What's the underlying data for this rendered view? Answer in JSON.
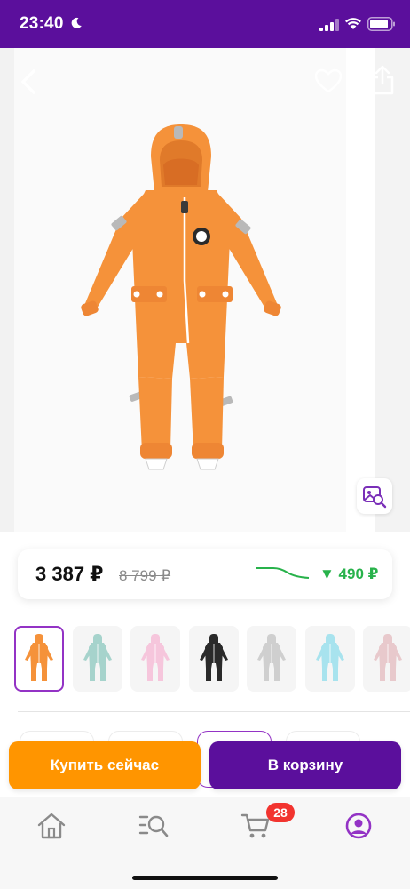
{
  "status_bar": {
    "time": "23:40",
    "background": "#5b0f9c"
  },
  "hero": {
    "icons": [
      "back-arrow-icon",
      "heart-icon",
      "share-icon",
      "visual-search-icon"
    ],
    "product_color": "#f5923a"
  },
  "price": {
    "current": "3 387 ₽",
    "old": "8 799 ₽",
    "drop": "▼ 490 ₽",
    "drop_color": "#28b24b"
  },
  "color_variants": [
    {
      "color": "#f5923a",
      "selected": true
    },
    {
      "color": "#a6d3cc",
      "selected": false
    },
    {
      "color": "#f6c6dc",
      "selected": false
    },
    {
      "color": "#2a2a2a",
      "selected": false
    },
    {
      "color": "#cfcfcf",
      "selected": false
    },
    {
      "color": "#a8e3ee",
      "selected": false
    },
    {
      "color": "#e8c9cc",
      "selected": false
    }
  ],
  "actions": {
    "buy_now": "Купить сейчас",
    "add_to_cart": "В корзину",
    "buy_now_color": "#ff9500",
    "cart_color": "#5b0f9c"
  },
  "bottom_nav": {
    "items": [
      "home-icon",
      "catalog-search-icon",
      "cart-icon",
      "profile-icon"
    ],
    "cart_badge": "28",
    "active_color": "#9333c5"
  }
}
